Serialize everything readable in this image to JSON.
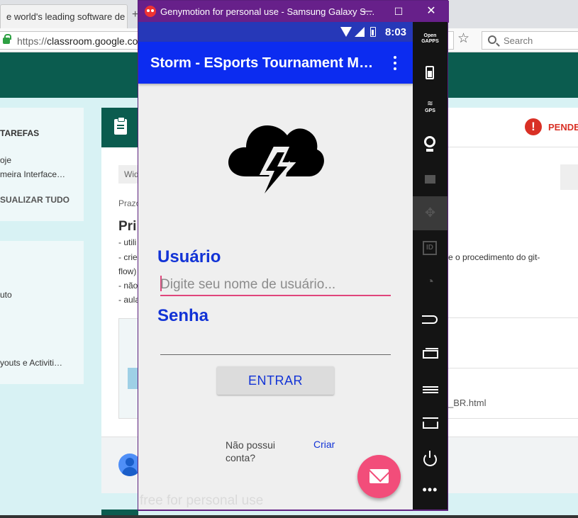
{
  "browser": {
    "tab_title": "e world's leading software de",
    "url_prefix": "https://",
    "url_domain": "classroom.google.co",
    "search_placeholder": "Search",
    "star_glyph": "☆",
    "tab_plus": "+"
  },
  "classroom": {
    "left_panel": {
      "heading": "TAREFAS",
      "items": [
        "oje",
        "meira Interface…"
      ],
      "view_all": "SUALIZAR TUDO",
      "second_items": [
        "uto",
        "youts e Activiti…"
      ]
    },
    "pending_label": "PENDE",
    "chip_label": "Wid",
    "deadline_label": "Prazo",
    "title": "Pri",
    "bullets": [
      "- utili",
      "- crie",
      "flow)",
      "- não",
      "- aula"
    ],
    "right_text": "e o procedimento do git-",
    "attachment_file": "_BR.html",
    "alert_glyph": "!"
  },
  "genymotion": {
    "window_title": "Genymotion for personal use - Samsung Galaxy S…",
    "window_controls": {
      "minimize": "—",
      "maximize": "☐",
      "close": "✕"
    },
    "watermark": "free for personal use",
    "sidebar": {
      "opengapps_label": "Open\nGAPPS",
      "gps_label": "GPS",
      "move_glyph": "✥",
      "rotate_glyph": "◔",
      "dots_glyph": "•••"
    }
  },
  "android": {
    "status_time": "8:03",
    "app_title": "Storm - ESports Tournament M…",
    "username_label": "Usuário",
    "username_placeholder": "Digite seu nome de usuário...",
    "password_label": "Senha",
    "login_button": "ENTRAR",
    "no_account_text": "Não possui conta?",
    "create_link": "Criar"
  },
  "colors": {
    "app_bar": "#0c2cf0",
    "status_bar": "#2638b8",
    "label_blue": "#1233d6",
    "accent_pink": "#e0457b",
    "fab": "#f24d7a",
    "genymotion_frame": "#67208a",
    "classroom_green": "#0b5c4f"
  }
}
